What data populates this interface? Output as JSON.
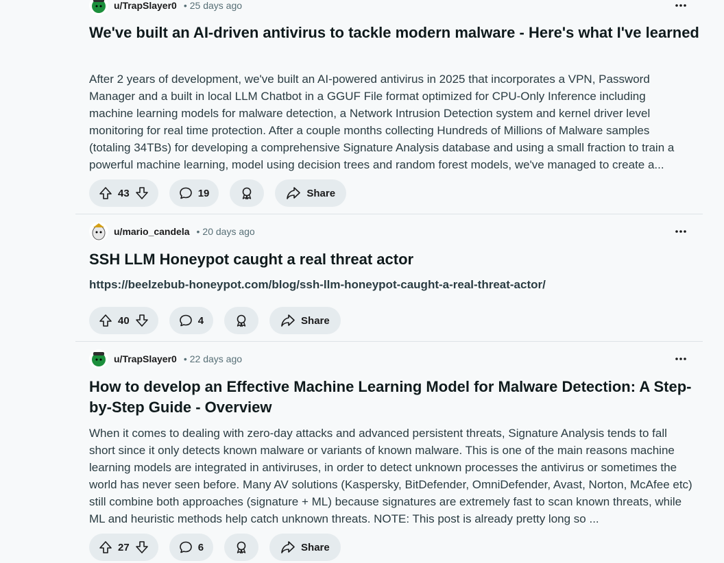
{
  "posts": [
    {
      "author": "u/TrapSlayer0",
      "age": "25 days ago",
      "title": "We've built an AI-driven antivirus to tackle modern malware - Here's what I've learned",
      "body": "After 2 years of development, we've built an AI-powered antivirus in 2025 that incorporates a VPN, Password Manager and a built in local LLM Chatbot in a GGUF File format optimized for CPU-Only Inference including machine learning models for malware detection, a Network Intrusion Detection system and kernel driver level monitoring for real time protection. After a couple months collecting Hundreds of Millions of Malware samples (totaling 34TBs) for developing a comprehensive Signature Analysis database and using a small fraction to train a powerful machine learning, model using decision trees and random forest models, we've managed to create a...",
      "votes": "43",
      "comments": "19",
      "share_label": "Share",
      "avatar_color": "#1c8f3c"
    },
    {
      "author": "u/mario_candela",
      "age": "20 days ago",
      "title": "SSH LLM Honeypot caught a real threat actor",
      "link": "https://beelzebub-honeypot.com/blog/ssh-llm-honeypot-caught-a-real-threat-actor/",
      "votes": "40",
      "comments": "4",
      "share_label": "Share",
      "avatar_color": "#d8d8d8"
    },
    {
      "author": "u/TrapSlayer0",
      "age": "22 days ago",
      "title": "How to develop an Effective Machine Learning Model for Malware Detection: A Step-by-Step Guide - Overview",
      "body": "When it comes to dealing with zero-day attacks and advanced persistent threats, Signature Analysis tends to fall short since it only detects known malware or variants of known malware. This is one of the main reasons machine learning models are integrated in antiviruses, in order to detect unknown processes the antivirus or sometimes the world has never seen before. Many AV solutions (Kaspersky, BitDefender, OmniDefender, Avast, Norton, McAfee etc) still combine both approaches (signature + ML) because signatures are extremely fast to scan known threats, while ML and heuristic methods help catch unknown threats. NOTE: This post is already pretty long so ...",
      "votes": "27",
      "comments": "6",
      "share_label": "Share",
      "avatar_color": "#1c8f3c"
    }
  ],
  "separator_color": "#dde3e6"
}
